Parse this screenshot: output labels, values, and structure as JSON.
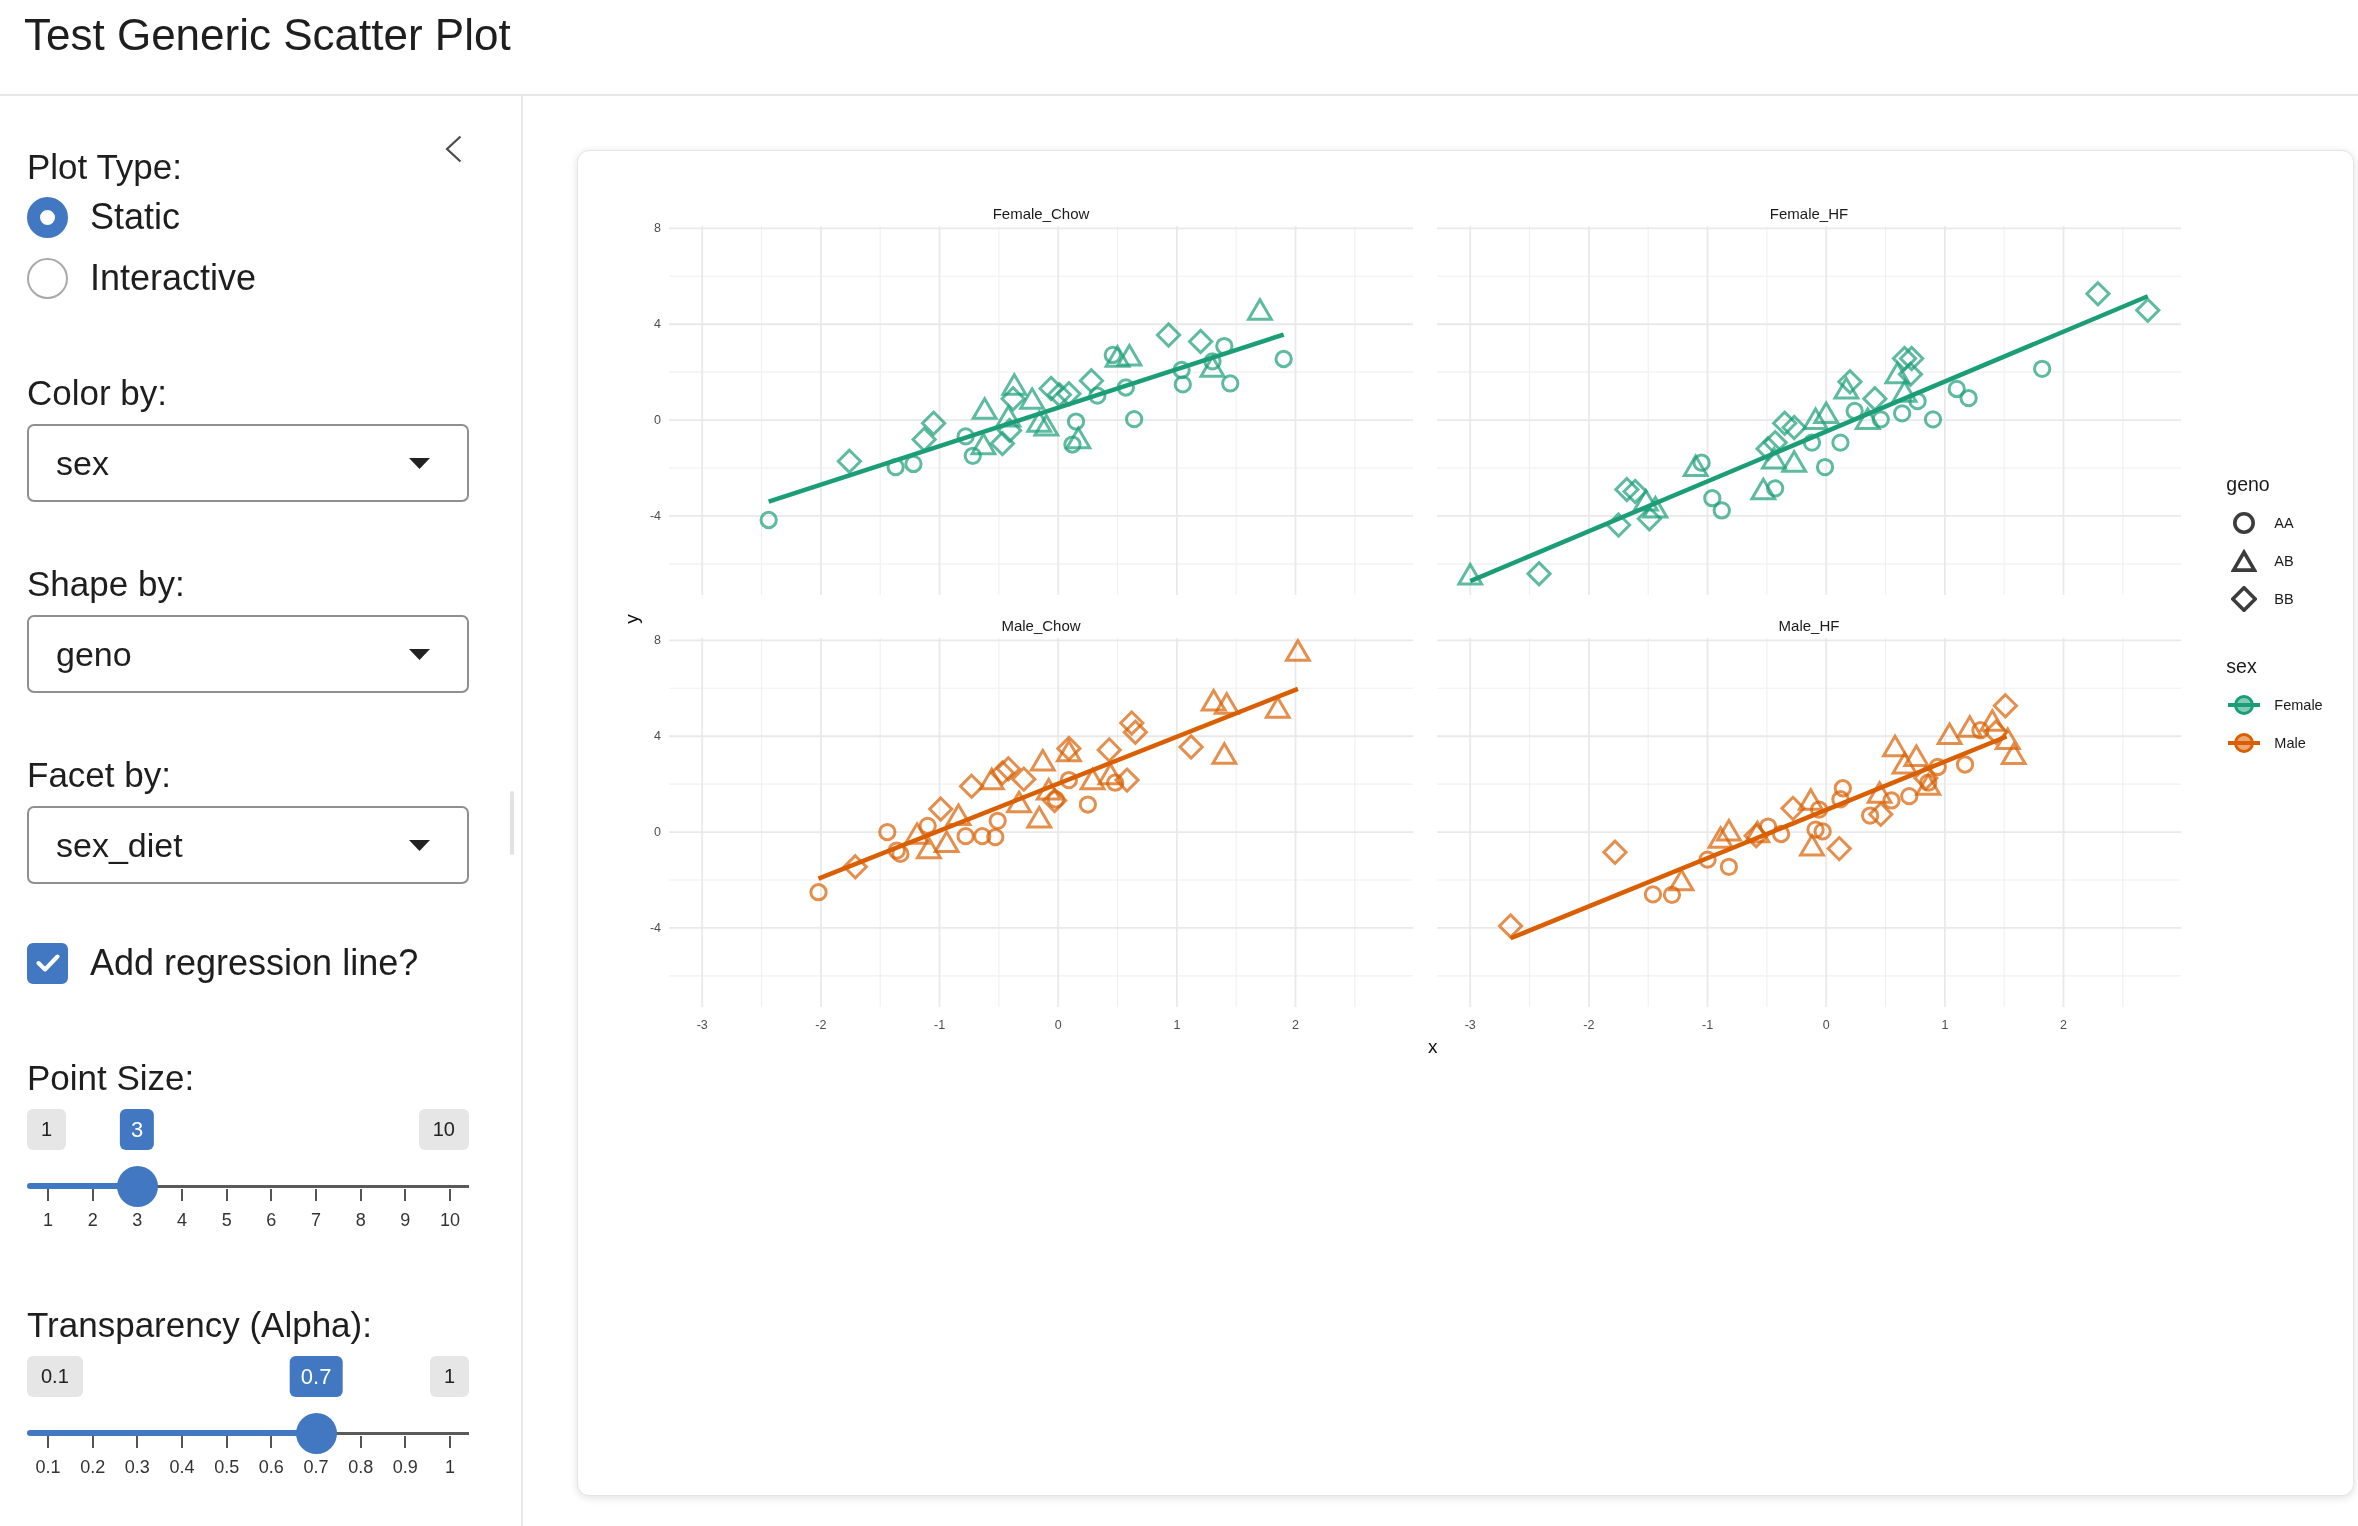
{
  "header": {
    "title": "Test Generic Scatter Plot"
  },
  "sidebar": {
    "controls": [
      {
        "kind": "radio",
        "label": "Plot Type:",
        "options": [
          {
            "label": "Static",
            "selected": true
          },
          {
            "label": "Interactive",
            "selected": false
          }
        ]
      },
      {
        "kind": "select",
        "label": "Color by:",
        "value": "sex"
      },
      {
        "kind": "select",
        "label": "Shape by:",
        "value": "geno"
      },
      {
        "kind": "select",
        "label": "Facet by:",
        "value": "sex_diet"
      },
      {
        "kind": "checkbox",
        "label": "Add regression line?",
        "checked": true
      },
      {
        "kind": "slider",
        "label": "Point Size:",
        "min": "1",
        "max": "10",
        "value": "3",
        "level": 0.222,
        "ticks": [
          "1",
          "2",
          "3",
          "4",
          "5",
          "6",
          "7",
          "8",
          "9",
          "10"
        ]
      },
      {
        "kind": "slider",
        "label": "Transparency (Alpha):",
        "min": "0.1",
        "max": "1",
        "value": "0.7",
        "level": 0.667,
        "ticks": [
          "0.1",
          "0.2",
          "0.3",
          "0.4",
          "0.5",
          "0.6",
          "0.7",
          "0.8",
          "0.9",
          "1"
        ]
      }
    ]
  },
  "plot": {
    "ylabel": "y",
    "xlabel": "x",
    "facets": [
      {
        "chart_data": {
          "type": "scatter",
          "title": "Female_Chow",
          "grid": true,
          "xlim": [
            -3.28,
            2.99
          ],
          "ylim": [
            -7.3,
            8.1
          ],
          "yticks": [
            -4,
            0,
            4,
            8
          ],
          "series": [
            {
              "color": "#1b9e77",
              "x": [
                -2.44,
                -1.37,
                -1.22,
                -0.78,
                -0.72,
                0.15,
                0.12,
                0.33,
                0.46,
                0.57,
                0.64,
                1.04,
                1.05,
                1.3,
                1.4,
                1.45,
                1.9
              ],
              "values": [
                -4.17,
                -1.96,
                -1.83,
                -0.68,
                -1.49,
                -0.06,
                -1.02,
                1.02,
                2.72,
                1.36,
                0.04,
                2.09,
                1.49,
                2.45,
                3.09,
                1.53,
                2.55
              ]
            },
            {
              "color": "#1b9e77",
              "x": [
                -0.62,
                -0.63,
                -0.37,
                -0.22,
                -0.16,
                -0.1,
                -0.42,
                0.17,
                0.5,
                0.6,
                1.3,
                1.7
              ],
              "values": [
                0.38,
                -1.1,
                1.38,
                0.79,
                -0.17,
                -0.32,
                0.05,
                -0.85,
                2.55,
                2.6,
                2.13,
                4.51
              ]
            },
            {
              "color": "#1b9e77",
              "x": [
                -1.76,
                -1.13,
                -1.05,
                -0.47,
                -0.41,
                -0.38,
                -0.06,
                0.01,
                0.09,
                0.28,
                0.93,
                1.2
              ],
              "values": [
                -1.72,
                -0.81,
                -0.13,
                -0.98,
                -0.43,
                0.89,
                1.32,
                1.06,
                1.1,
                1.64,
                3.55,
                3.28
              ]
            },
            {
              "type": "line",
              "color": "#1b9e77",
              "x": [
                -2.44,
                1.9
              ],
              "values": [
                -3.4,
                3.57
              ]
            }
          ]
        }
      },
      {
        "chart_data": {
          "type": "scatter",
          "title": "Female_HF",
          "grid": true,
          "xlim": [
            -3.28,
            2.99
          ],
          "ylim": [
            -7.3,
            8.1
          ],
          "series": [
            {
              "color": "#1b9e77",
              "x": [
                -1.05,
                -0.96,
                -0.88,
                -0.43,
                -0.12,
                -0.01,
                0.12,
                0.24,
                0.46,
                0.64,
                0.77,
                0.9,
                1.1,
                1.2,
                1.82
              ],
              "values": [
                -1.78,
                -3.26,
                -3.77,
                -2.85,
                -0.94,
                -1.96,
                -0.94,
                0.38,
                0.03,
                0.28,
                0.79,
                0.03,
                1.3,
                0.92,
                2.14
              ]
            },
            {
              "color": "#1b9e77",
              "x": [
                -3.0,
                -1.1,
                -1.44,
                -1.52,
                -0.53,
                -0.44,
                -0.27,
                -0.09,
                0.0,
                0.17,
                0.35,
                0.6,
                0.66
              ],
              "values": [
                -6.54,
                -2.01,
                -3.74,
                -3.45,
                -2.98,
                -1.7,
                -1.83,
                -0.05,
                0.2,
                1.22,
                -0.05,
                1.86,
                1.09
              ]
            },
            {
              "color": "#1b9e77",
              "x": [
                -2.42,
                -1.75,
                -1.68,
                -1.61,
                -1.49,
                -0.49,
                -0.43,
                -0.35,
                -0.27,
                0.2,
                0.41,
                0.66,
                0.72,
                0.71,
                2.29,
                2.71
              ],
              "values": [
                -6.41,
                -4.38,
                -2.9,
                -2.98,
                -4.12,
                -1.2,
                -0.94,
                -0.13,
                -0.31,
                1.6,
                0.89,
                2.57,
                2.57,
                1.91,
                5.27,
                4.58
              ]
            },
            {
              "type": "line",
              "color": "#1b9e77",
              "x": [
                -3.0,
                2.71
              ],
              "values": [
                -6.72,
                5.17
              ]
            }
          ]
        }
      },
      {
        "chart_data": {
          "type": "scatter",
          "title": "Male_Chow",
          "grid": true,
          "xlim": [
            -3.28,
            2.99
          ],
          "ylim": [
            -7.3,
            8.1
          ],
          "xticks": [
            -3,
            -2,
            -1,
            0,
            1,
            2
          ],
          "yticks": [
            -4,
            0,
            4,
            8
          ],
          "series": [
            {
              "color": "#d95f02",
              "x": [
                -2.02,
                -1.44,
                -1.36,
                -1.33,
                -1.1,
                -0.78,
                -0.64,
                -0.53,
                -0.51,
                -0.02,
                0.09,
                0.25,
                0.48
              ],
              "values": [
                -2.51,
                0.0,
                -0.77,
                -0.91,
                0.26,
                -0.17,
                -0.17,
                -0.21,
                0.47,
                1.36,
                2.17,
                1.15,
                2.06
              ]
            },
            {
              "color": "#d95f02",
              "x": [
                -1.19,
                -1.09,
                -0.94,
                -0.84,
                -0.56,
                -0.33,
                -0.16,
                -0.13,
                -0.08,
                0.09,
                0.29,
                0.44,
                1.31,
                1.42,
                1.4,
                1.85,
                2.02
              ],
              "values": [
                -0.17,
                -0.77,
                -0.51,
                0.62,
                2.11,
                1.15,
                0.51,
                2.89,
                1.68,
                3.28,
                2.11,
                2.32,
                5.4,
                5.26,
                3.17,
                5.09,
                7.47
              ]
            },
            {
              "color": "#d95f02",
              "x": [
                -1.71,
                -0.99,
                -0.73,
                -0.47,
                -0.42,
                -0.29,
                -0.03,
                0.09,
                0.43,
                0.58,
                0.62,
                0.65,
                1.12
              ],
              "values": [
                -1.45,
                0.96,
                1.91,
                2.47,
                2.64,
                2.21,
                1.32,
                3.49,
                3.43,
                2.17,
                4.55,
                4.17,
                3.55
              ]
            },
            {
              "type": "line",
              "color": "#d95f02",
              "x": [
                -2.02,
                2.02
              ],
              "values": [
                -1.94,
                5.98
              ]
            }
          ]
        }
      },
      {
        "chart_data": {
          "type": "scatter",
          "title": "Male_HF",
          "grid": true,
          "xlim": [
            -3.28,
            2.99
          ],
          "ylim": [
            -7.3,
            8.1
          ],
          "xticks": [
            -3,
            -2,
            -1,
            0,
            1,
            2
          ],
          "series": [
            {
              "color": "#d95f02",
              "x": [
                -1.46,
                -1.3,
                -1.0,
                -0.82,
                -0.49,
                -0.38,
                -0.09,
                -0.03,
                -0.06,
                0.12,
                0.14,
                0.37,
                0.55,
                0.7,
                0.86,
                0.94,
                1.17,
                1.3
              ],
              "values": [
                -2.6,
                -2.62,
                -1.15,
                -1.45,
                0.23,
                -0.08,
                0.1,
                0.03,
                0.94,
                1.37,
                1.83,
                0.69,
                1.32,
                1.5,
                2.06,
                2.72,
                2.82,
                4.25
              ]
            },
            {
              "color": "#d95f02",
              "x": [
                -1.22,
                -0.89,
                -0.82,
                -0.58,
                -0.13,
                -0.12,
                0.45,
                0.58,
                0.66,
                0.76,
                0.86,
                1.04,
                1.21,
                1.4,
                1.53,
                1.58
              ],
              "values": [
                -2.11,
                -0.33,
                -0.03,
                -0.1,
                1.25,
                -0.66,
                1.55,
                3.49,
                2.77,
                3.08,
                1.88,
                4.0,
                4.3,
                4.55,
                3.79,
                3.16
              ]
            },
            {
              "color": "#d95f02",
              "x": [
                -2.66,
                -1.78,
                -0.59,
                -0.28,
                0.11,
                0.46,
                0.84,
                1.51,
                1.43
              ],
              "values": [
                -3.92,
                -0.84,
                -0.15,
                0.99,
                -0.69,
                0.74,
                2.26,
                5.27,
                4.17
              ]
            },
            {
              "type": "line",
              "color": "#d95f02",
              "x": [
                -2.66,
                1.52
              ],
              "values": [
                -4.43,
                3.99
              ]
            }
          ]
        }
      }
    ],
    "legends": [
      {
        "kind": "shape",
        "title": "geno",
        "items": [
          {
            "label": "AA",
            "kind": "circle"
          },
          {
            "label": "AB",
            "kind": "triangle"
          },
          {
            "label": "BB",
            "kind": "diamond"
          }
        ]
      },
      {
        "kind": "color",
        "title": "sex",
        "items": [
          {
            "label": "Female",
            "color": "#1b9e77"
          },
          {
            "label": "Male",
            "color": "#d95f02"
          }
        ]
      }
    ]
  }
}
